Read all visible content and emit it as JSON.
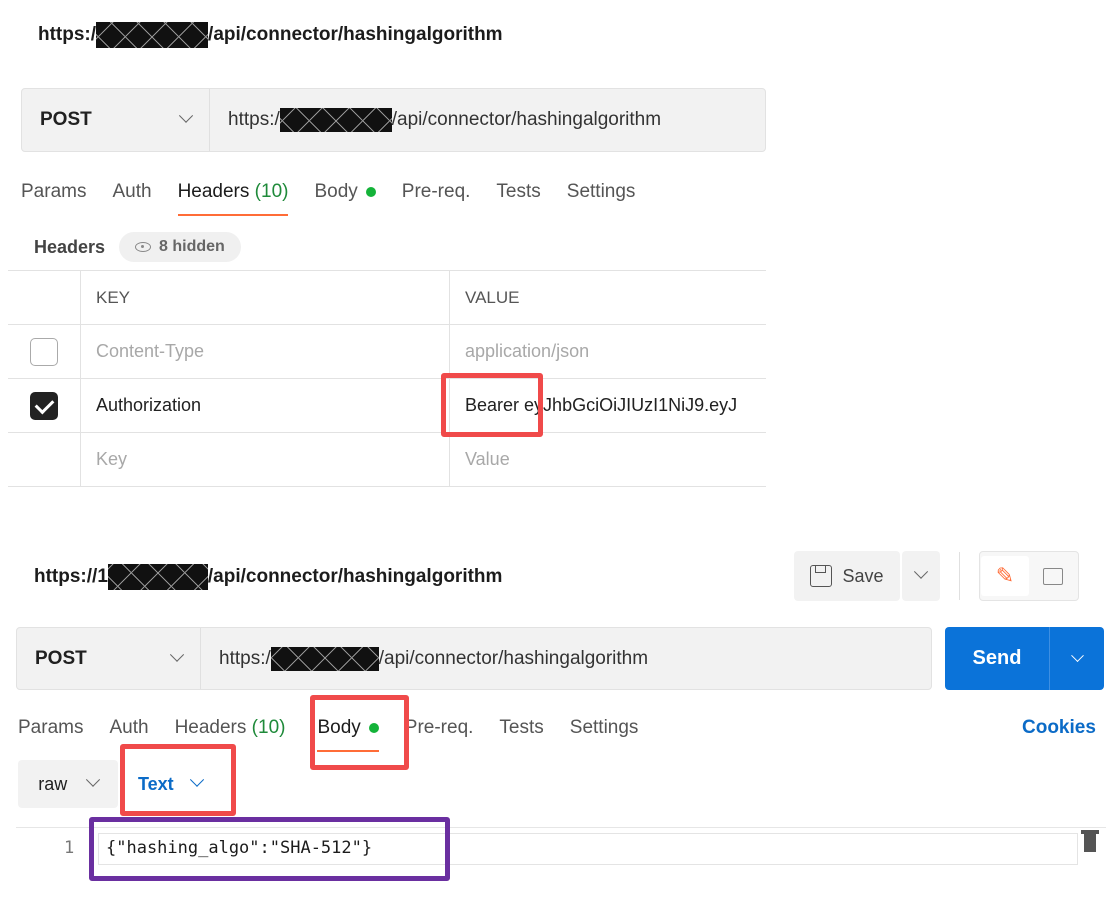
{
  "top": {
    "title": {
      "prefix": "https:/",
      "suffix": "/api/connector/hashingalgorithm"
    },
    "method": "POST",
    "url": {
      "prefix": "https:/",
      "suffix": "/api/connector/hashingalgorithm"
    },
    "tabs": [
      {
        "label": "Params"
      },
      {
        "label": "Auth"
      },
      {
        "label": "Headers",
        "count": "(10)"
      },
      {
        "label": "Body"
      },
      {
        "label": "Pre-req."
      },
      {
        "label": "Tests"
      },
      {
        "label": "Settings"
      }
    ],
    "headers_label": "Headers",
    "hidden_label": "8 hidden",
    "table": {
      "columns": [
        "KEY",
        "VALUE"
      ],
      "rows": [
        {
          "checked": false,
          "key": "Content-Type",
          "value": "application/json"
        },
        {
          "checked": true,
          "key": "Authorization",
          "value_prefix": "Bearer",
          "value_rest": "eyJhbGciOiJIUzI1NiJ9.eyJ"
        }
      ],
      "placeholder": {
        "key": "Key",
        "value": "Value"
      }
    }
  },
  "bottom": {
    "title": {
      "prefix": "https://1",
      "suffix": "/api/connector/hashingalgorithm"
    },
    "save_label": "Save",
    "method": "POST",
    "url": {
      "prefix": "https:/",
      "suffix": "/api/connector/hashingalgorithm"
    },
    "send_label": "Send",
    "tabs": [
      {
        "label": "Params"
      },
      {
        "label": "Auth"
      },
      {
        "label": "Headers",
        "count": "(10)"
      },
      {
        "label": "Body"
      },
      {
        "label": "Pre-req."
      },
      {
        "label": "Tests"
      },
      {
        "label": "Settings"
      }
    ],
    "cookies_label": "Cookies",
    "body_mode": "raw",
    "body_format": "Text",
    "editor": {
      "line_number": "1",
      "code": "{\"hashing_algo\":\"SHA-512\"}"
    }
  },
  "colors": {
    "accent": "#ff6c37",
    "send": "#0b73d9",
    "highlight_red": "#f04a4a",
    "highlight_purple": "#6a2fa0",
    "count_green": "#1f8a3a"
  }
}
